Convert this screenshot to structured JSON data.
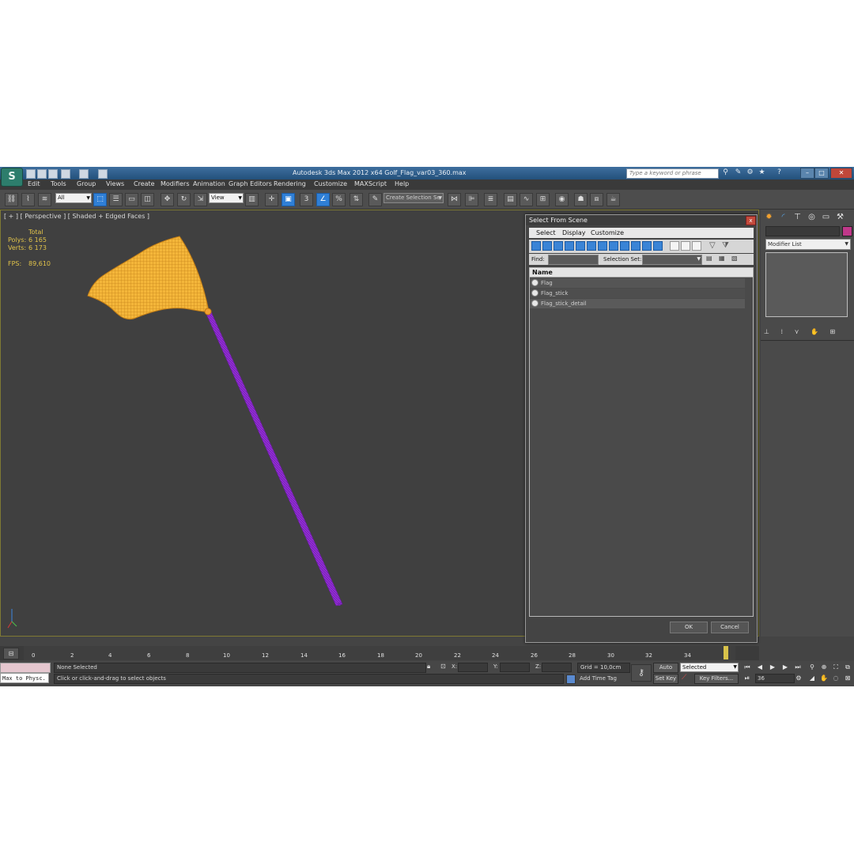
{
  "app": {
    "logo": "S",
    "title": "Autodesk 3ds Max  2012 x64      Golf_Flag_var03_360.max",
    "search_placeholder": "Type a keyword or phrase",
    "help": "?"
  },
  "menu": [
    "Edit",
    "Tools",
    "Group",
    "Views",
    "Create",
    "Modifiers",
    "Animation",
    "Graph Editors",
    "Rendering",
    "Customize",
    "MAXScript",
    "Help"
  ],
  "toolbar": {
    "filter": "All",
    "ref_coord": "View",
    "snap_num": "3",
    "named_set": "Create Selection Se"
  },
  "viewport": {
    "label": "[ + ] [ Perspective ] [ Shaded + Edged Faces ]",
    "stats": {
      "total_label": "Total",
      "polys_label": "Polys:",
      "polys": "6 165",
      "verts_label": "Verts:",
      "verts": "6 173",
      "fps_label": "FPS:",
      "fps": "89,610"
    },
    "colors": {
      "flag": "#f0b030",
      "stick": "#8a2bd0",
      "viewport_border": "#7f7a33"
    }
  },
  "command_panel": {
    "modifier_list": "Modifier List",
    "accent": "#c0388a"
  },
  "dialog": {
    "title": "Select From Scene",
    "close": "x",
    "menu": [
      "Select",
      "Display",
      "Customize"
    ],
    "find_label": "Find:",
    "selection_set_label": "Selection Set:",
    "column_name": "Name",
    "items": [
      "Flag",
      "Flag_stick",
      "Flag_stick_detail"
    ],
    "ok": "OK",
    "cancel": "Cancel"
  },
  "timeline": {
    "ticks": [
      "0",
      "2",
      "4",
      "6",
      "8",
      "10",
      "12",
      "14",
      "16",
      "18",
      "20",
      "22",
      "24",
      "26",
      "28",
      "30",
      "32",
      "34"
    ],
    "frame_display": "36 / 36"
  },
  "status": {
    "maxscript_mini": "Max to Physc.",
    "selection": "None Selected",
    "prompt": "Click or click-and-drag to select objects",
    "x_label": "X:",
    "y_label": "Y:",
    "z_label": "Z:",
    "grid": "Grid = 10,0cm",
    "add_time_tag": "Add Time Tag",
    "auto_key": "Auto Key",
    "set_key": "Set Key",
    "key_mode": "Selected",
    "key_filters": "Key Filters...",
    "frame": "36"
  }
}
